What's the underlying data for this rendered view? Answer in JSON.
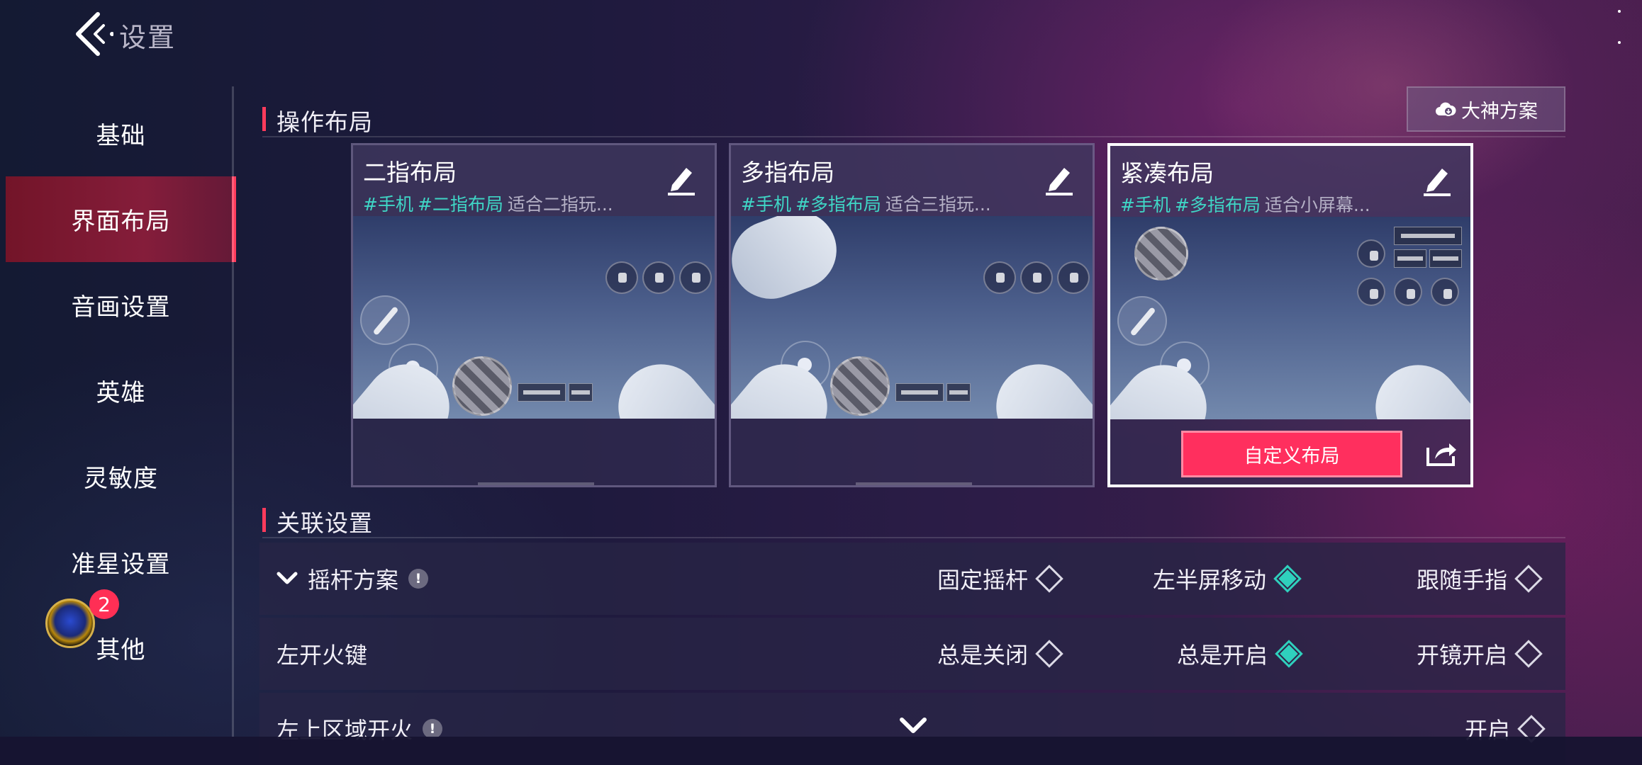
{
  "header": {
    "title": "设置"
  },
  "sidebar": {
    "items": [
      {
        "label": "基础"
      },
      {
        "label": "界面布局"
      },
      {
        "label": "音画设置"
      },
      {
        "label": "英雄"
      },
      {
        "label": "灵敏度"
      },
      {
        "label": "准星设置"
      },
      {
        "label": "其他"
      }
    ],
    "active_index": 1,
    "badge_count": "2"
  },
  "layout_section": {
    "title": "操作布局",
    "pro_button_label": "大神方案",
    "cards": [
      {
        "title": "二指布局",
        "tags": [
          "#手机",
          "#二指布局"
        ],
        "desc": "适合二指玩..."
      },
      {
        "title": "多指布局",
        "tags": [
          "#手机",
          "#多指布局"
        ],
        "desc": "适合三指玩..."
      },
      {
        "title": "紧凑布局",
        "tags": [
          "#手机",
          "#多指布局"
        ],
        "desc": "适合小屏幕...",
        "button_label": "自定义布局"
      }
    ],
    "selected_index": 2
  },
  "related_section": {
    "title": "关联设置",
    "rows": [
      {
        "label": "摇杆方案",
        "options": [
          "固定摇杆",
          "左半屏移动",
          "跟随手指"
        ],
        "selected": 1
      },
      {
        "label": "左开火键",
        "options": [
          "总是关闭",
          "总是开启",
          "开镜开启"
        ],
        "selected": 1
      },
      {
        "label": "左上区域开火",
        "options": [
          "开启"
        ],
        "selected": -1
      }
    ]
  },
  "colors": {
    "accent": "#ff3b5c",
    "teal": "#2fd0bd",
    "tag": "#3fd6c6"
  }
}
